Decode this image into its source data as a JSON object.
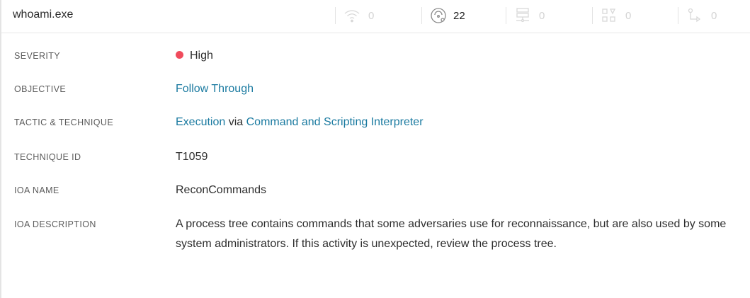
{
  "header": {
    "title": "whoami.exe",
    "stats": [
      {
        "icon": "wifi-icon",
        "count": "0",
        "active": false
      },
      {
        "icon": "disk-icon",
        "count": "22",
        "active": true
      },
      {
        "icon": "network-drive-icon",
        "count": "0",
        "active": false
      },
      {
        "icon": "grid-icon",
        "count": "0",
        "active": false
      },
      {
        "icon": "process-flow-icon",
        "count": "0",
        "active": false
      }
    ]
  },
  "details": {
    "severity": {
      "label": "SEVERITY",
      "value": "High",
      "color": "#f04b5c"
    },
    "objective": {
      "label": "OBJECTIVE",
      "value": "Follow Through"
    },
    "tactic": {
      "label": "TACTIC & TECHNIQUE",
      "tactic": "Execution",
      "connector": "via",
      "technique": "Command and Scripting Interpreter"
    },
    "technique_id": {
      "label": "TECHNIQUE ID",
      "value": "T1059"
    },
    "ioa_name": {
      "label": "IOA NAME",
      "value": "ReconCommands"
    },
    "ioa_description": {
      "label": "IOA DESCRIPTION",
      "value": "A process tree contains commands that some adversaries use for reconnaissance, but are also used by some system administrators. If this activity is unexpected, review the process tree."
    }
  },
  "colors": {
    "link": "#1a7aa0",
    "muted_count": "#d4d4d4",
    "label": "#5c5c5c"
  }
}
